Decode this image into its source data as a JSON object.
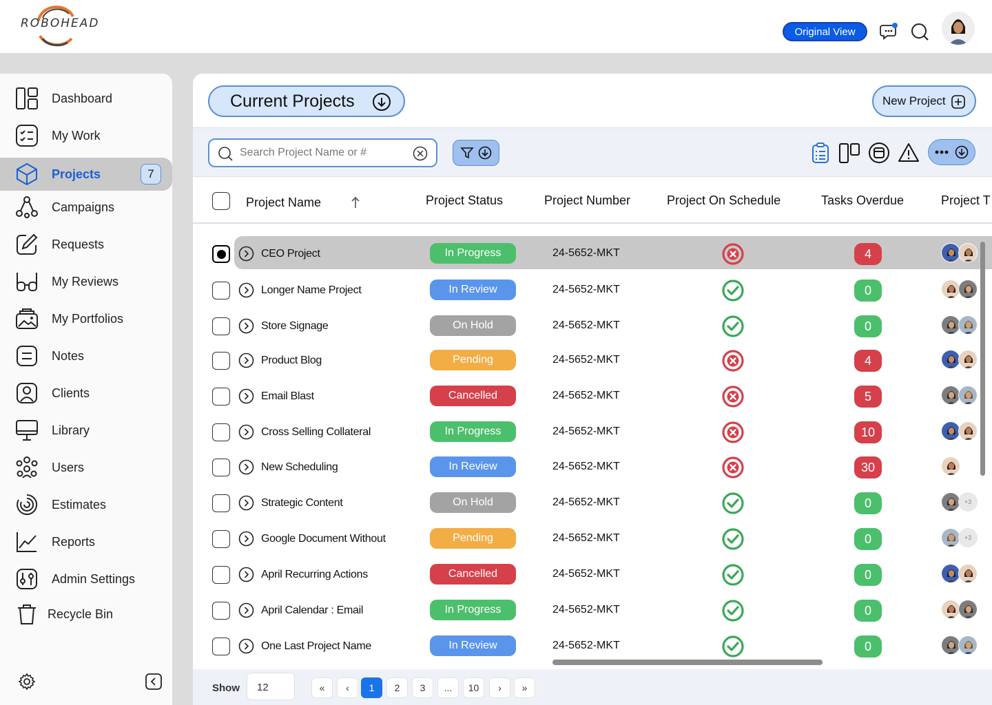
{
  "header": {
    "logo_text": "ROBOHEAD",
    "original_view_label": "Original View",
    "icons": [
      "chat-notification-icon",
      "search-icon",
      "user-avatar"
    ]
  },
  "sidebar": {
    "items": [
      {
        "label": "Dashboard",
        "icon": "dashboard-icon"
      },
      {
        "label": "My Work",
        "icon": "checklist-icon"
      },
      {
        "label": "Projects",
        "icon": "cube-icon",
        "badge": "7",
        "active": true
      },
      {
        "label": "Campaigns",
        "icon": "network-icon"
      },
      {
        "label": "Requests",
        "icon": "edit-icon"
      },
      {
        "label": "My Reviews",
        "icon": "glasses-icon"
      },
      {
        "label": "My Portfolios",
        "icon": "portfolio-icon"
      },
      {
        "label": "Notes",
        "icon": "notes-icon"
      },
      {
        "label": "Clients",
        "icon": "client-icon"
      },
      {
        "label": "Library",
        "icon": "monitor-icon"
      },
      {
        "label": "Users",
        "icon": "users-icon"
      },
      {
        "label": "Estimates",
        "icon": "estimates-icon"
      },
      {
        "label": "Reports",
        "icon": "chart-line-icon"
      },
      {
        "label": "Admin Settings",
        "icon": "sliders-icon"
      },
      {
        "label": "Recycle Bin",
        "icon": "trash-icon"
      }
    ]
  },
  "main": {
    "view_title": "Current Projects",
    "new_project_label": "New Project",
    "search_placeholder": "Search Project Name or #",
    "columns": [
      "Project Name",
      "Project Status",
      "Project  Number",
      "Project On Schedule",
      "Tasks Overdue",
      "Project T"
    ],
    "rows": [
      {
        "name": "CEO Project",
        "status": "In Progress",
        "number": "24-5652-MKT",
        "on_schedule": false,
        "overdue": "4",
        "selected": true,
        "avatars": [
          "a1",
          "a2"
        ]
      },
      {
        "name": "Longer Name Project",
        "status": "In Review",
        "number": "24-5652-MKT",
        "on_schedule": true,
        "overdue": "0",
        "avatars": [
          "a2",
          "a3"
        ]
      },
      {
        "name": "Store Signage",
        "status": "On Hold",
        "number": "24-5652-MKT",
        "on_schedule": true,
        "overdue": "0",
        "avatars": [
          "a3",
          "a4"
        ]
      },
      {
        "name": "Product Blog",
        "status": "Pending",
        "number": "24-5652-MKT",
        "on_schedule": false,
        "overdue": "4",
        "avatars": [
          "a1",
          "a2"
        ]
      },
      {
        "name": "Email Blast",
        "status": "Cancelled",
        "number": "24-5652-MKT",
        "on_schedule": false,
        "overdue": "5",
        "avatars": [
          "a3",
          "a4"
        ]
      },
      {
        "name": "Cross Selling Collateral",
        "status": "In Progress",
        "number": "24-5652-MKT",
        "on_schedule": false,
        "overdue": "10",
        "avatars": [
          "a1",
          "a2"
        ]
      },
      {
        "name": "New Scheduling",
        "status": "In Review",
        "number": "24-5652-MKT",
        "on_schedule": false,
        "overdue": "30",
        "avatars": [
          "a2"
        ]
      },
      {
        "name": "Strategic Content",
        "status": "On Hold",
        "number": "24-5652-MKT",
        "on_schedule": true,
        "overdue": "0",
        "avatars": [
          "a3"
        ],
        "more": "+3"
      },
      {
        "name": "Google Document Without",
        "status": "Pending",
        "number": "24-5652-MKT",
        "on_schedule": true,
        "overdue": "0",
        "avatars": [
          "a4"
        ],
        "more": "+3"
      },
      {
        "name": "April Recurring Actions",
        "status": "Cancelled",
        "number": "24-5652-MKT",
        "on_schedule": true,
        "overdue": "0",
        "avatars": [
          "a1",
          "a2"
        ]
      },
      {
        "name": "April Calendar : Email",
        "status": "In Progress",
        "number": "24-5652-MKT",
        "on_schedule": true,
        "overdue": "0",
        "avatars": [
          "a2",
          "a3"
        ]
      },
      {
        "name": "One Last Project Name",
        "status": "In Review",
        "number": "24-5652-MKT",
        "on_schedule": true,
        "overdue": "0",
        "avatars": [
          "a3",
          "a4"
        ]
      }
    ],
    "status_colors": {
      "In Progress": "#4cbf6c",
      "In Review": "#5a95ec",
      "On Hold": "#a3a3a3",
      "Pending": "#f2ad45",
      "Cancelled": "#d6404a"
    },
    "overdue_colors": {
      "zero": "#4cbf6c",
      "nonzero": "#d6404a"
    }
  },
  "footer": {
    "show_label": "Show",
    "page_size": "12",
    "pages": [
      "«",
      "‹",
      "1",
      "2",
      "3",
      "...",
      "10",
      "›",
      "»"
    ],
    "current_page": "1"
  }
}
